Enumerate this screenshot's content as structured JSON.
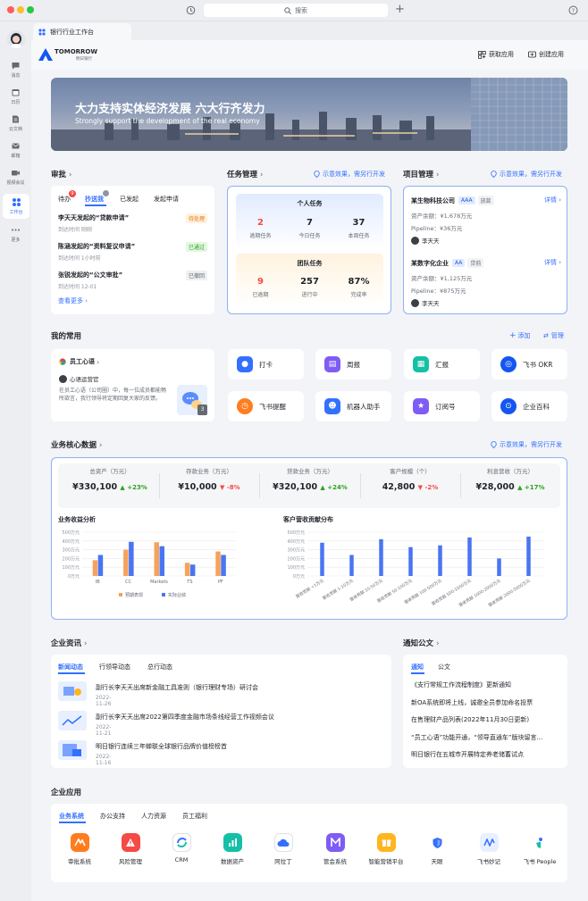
{
  "window": {
    "search_placeholder": "搜索"
  },
  "tab": {
    "label": "银行行业工作台"
  },
  "sidebar": {
    "items": [
      {
        "label": "消息",
        "icon": "message-icon"
      },
      {
        "label": "日历",
        "icon": "calendar-icon"
      },
      {
        "label": "云文档",
        "icon": "docs-icon"
      },
      {
        "label": "邮箱",
        "icon": "mail-icon"
      },
      {
        "label": "视频会议",
        "icon": "video-icon"
      },
      {
        "label": "工作台",
        "icon": "workplace-icon"
      },
      {
        "label": "更多",
        "icon": "more-icon"
      }
    ]
  },
  "header": {
    "logo_text": "TOMORROW",
    "logo_sub": "明日银行",
    "get_apps": "获取应用",
    "create_app": "创建应用"
  },
  "banner": {
    "title": "大力支持实体经济发展 六大行齐发力",
    "subtitle": "Strongly support the development of the real economy"
  },
  "approval": {
    "title": "审批",
    "tabs": [
      "待办",
      "抄送我",
      "已发起",
      "发起申请"
    ],
    "badge": "9",
    "items": [
      {
        "title": "李天天发起的“贷款申请”",
        "meta": "到达时间 刚刚",
        "status": "待处理"
      },
      {
        "title": "陈涵发起的“资料复议申请”",
        "meta": "到达时间 1小时前",
        "status": "已通过"
      },
      {
        "title": "张锐发起的“公文审批”",
        "meta": "到达时间 12-01",
        "status": "已撤回"
      }
    ],
    "more": "查看更多"
  },
  "tasks": {
    "title": "任务管理",
    "hint": "示意效果，需另行开发",
    "personal": {
      "title": "个人任务",
      "stats": [
        {
          "v": "2",
          "l": "逾期任务"
        },
        {
          "v": "7",
          "l": "今日任务"
        },
        {
          "v": "37",
          "l": "本周任务"
        }
      ]
    },
    "team": {
      "title": "团队任务",
      "stats": [
        {
          "v": "9",
          "l": "已逾期"
        },
        {
          "v": "257",
          "l": "进行中"
        },
        {
          "v": "87%",
          "l": "完成率"
        }
      ]
    }
  },
  "projects": {
    "title": "项目管理",
    "hint": "示意效果，需另行开发",
    "items": [
      {
        "name": "某生物科技公司",
        "grade": "AAA",
        "stage": "放款",
        "detail": "详情",
        "assets": "资产余额：¥1,678万元",
        "pipeline": "Pipeline：¥36万元",
        "owner": "李天天"
      },
      {
        "name": "某数字化企业",
        "grade": "AA",
        "stage": "贷前",
        "detail": "详情",
        "assets": "资产余额：¥1,125万元",
        "pipeline": "Pipeline：¥875万元",
        "owner": "李天天"
      }
    ]
  },
  "favorites": {
    "title": "我的常用",
    "add": "添加",
    "manage": "管理",
    "voice": {
      "title": "员工心语",
      "sub": "心语运营官",
      "text": "在员工心语（公司圈）中，每一位成员都能畅所欲言，我行领导将定期回复大家的反馈。",
      "badge": "3"
    },
    "items": [
      "打卡",
      "周报",
      "汇报",
      "飞书 OKR",
      "飞书提醒",
      "机器人助手",
      "订阅号",
      "企业百科"
    ]
  },
  "core": {
    "title": "业务核心数据",
    "hint": "示意效果，需另行开发",
    "kpis": [
      {
        "label": "总资产（万元）",
        "value": "¥330,100",
        "change": "+23%",
        "dir": "up"
      },
      {
        "label": "存款业务（万元）",
        "value": "¥10,000",
        "change": "-8%",
        "dir": "down"
      },
      {
        "label": "贷款业务（万元）",
        "value": "¥320,100",
        "change": "+24%",
        "dir": "up"
      },
      {
        "label": "客户规模（个）",
        "value": "42,800",
        "change": "-2%",
        "dir": "down"
      },
      {
        "label": "利息营收（万元）",
        "value": "¥28,000",
        "change": "+17%",
        "dir": "up"
      }
    ]
  },
  "chart_data": [
    {
      "type": "bar",
      "title": "业务收益分析",
      "categories": [
        "IB",
        "CC",
        "Markets",
        "TS",
        "PF"
      ],
      "series": [
        {
          "name": "预期表现",
          "color": "#f5a25d",
          "values": [
            180,
            300,
            385,
            150,
            280
          ]
        },
        {
          "name": "实际业绩",
          "color": "#4975f2",
          "values": [
            240,
            390,
            340,
            130,
            240
          ]
        }
      ],
      "yticks": [
        "0万元",
        "100万元",
        "200万元",
        "300万元",
        "400万元",
        "500万元"
      ],
      "ylim": [
        0,
        500
      ],
      "grid": true,
      "legend": "bottom"
    },
    {
      "type": "bar",
      "title": "客户营收贡献分布",
      "categories": [
        "营收贡献 <1万元",
        "营收贡献 1-10万元",
        "营收贡献 10-50万元",
        "营收贡献 50-100万元",
        "营收贡献 100-500万元",
        "营收贡献 500-1000万元",
        "营收贡献 1000-2000万元",
        "营收贡献 2000-5000万元"
      ],
      "series": [
        {
          "color": "#4975f2",
          "values": [
            380,
            240,
            420,
            330,
            350,
            440,
            200,
            450
          ]
        }
      ],
      "yticks": [
        "0万元",
        "100万元",
        "200万元",
        "300万元",
        "400万元",
        "500万元"
      ],
      "ylim": [
        0,
        500
      ],
      "grid": true
    }
  ],
  "news": {
    "title": "企业资讯",
    "tabs": [
      "新闻动态",
      "行领导动态",
      "总行动态"
    ],
    "items": [
      {
        "title": "副行长李天天出席新金融工具准则（银行理财专场）研讨会",
        "date": "2022-11-26"
      },
      {
        "title": "副行长李天天出席2022第四季度金融市场条线经营工作视频会议",
        "date": "2022-11-21"
      },
      {
        "title": "明日银行连续三年蝉联全球银行品牌价值榜榜首",
        "date": "2022-11-16"
      }
    ]
  },
  "notices": {
    "title": "通知公文",
    "tabs": [
      "通知",
      "公文"
    ],
    "items": [
      "《支行常规工作流程制度》更新通知",
      "新OA系统即将上线，诚邀全员参加命名投票",
      "在售理财产品列表(2022年11月30日更新)",
      "“员工心语”功能开通，“领导直通车”版块留言...",
      "明日银行在五城市开展特定养老储蓄试点"
    ]
  },
  "apps": {
    "title": "企业应用",
    "tabs": [
      "业务系统",
      "办公支持",
      "人力资源",
      "员工福利"
    ],
    "items": [
      {
        "label": "审批系统",
        "color": "#ff7d1f"
      },
      {
        "label": "风险管理",
        "color": "#f54a45"
      },
      {
        "label": "CRM",
        "color": "#3370ff"
      },
      {
        "label": "数据资产",
        "color": "#14c0a6"
      },
      {
        "label": "阿拉丁",
        "color": "#3370ff"
      },
      {
        "label": "管会系统",
        "color": "#7f5cf5"
      },
      {
        "label": "智能营销平台",
        "color": "#ffb51f"
      },
      {
        "label": "天眼",
        "color": "#3370ff"
      },
      {
        "label": "飞书妙记",
        "color": "#3370ff"
      },
      {
        "label": "飞书 People",
        "color": "#14c0a6"
      }
    ]
  }
}
